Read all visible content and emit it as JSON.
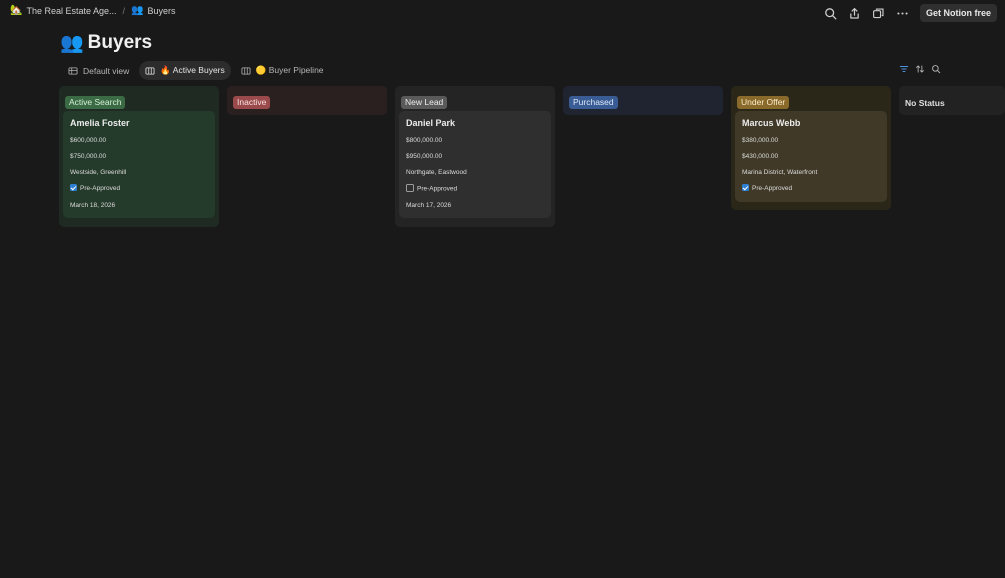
{
  "breadcrumb": {
    "workspace": "The Real Estate Age...",
    "workspace_icon": "🏡",
    "separator": "/",
    "page": "Buyers",
    "page_icon": "👥"
  },
  "top_actions": {
    "icons": [
      "search-icon",
      "share-icon",
      "duplicate-icon",
      "more-icon"
    ],
    "cta_label": "Get Notion free"
  },
  "page": {
    "icon": "👥",
    "title": "Buyers"
  },
  "views": [
    {
      "label": "Default view",
      "icon": "table-icon",
      "active": false
    },
    {
      "label": "🔥 Active Buyers",
      "icon": "board-icon",
      "active": true
    },
    {
      "label": "🟡 Buyer Pipeline",
      "icon": "board-icon",
      "active": false
    }
  ],
  "view_tools": [
    "filter-icon",
    "sort-icon",
    "search-icon"
  ],
  "columns": [
    {
      "status": "Active Search",
      "color": "#3b6b44",
      "text_color": "#d7f0d9",
      "bg": "#1f2a22",
      "cards": [
        {
          "name": "Amelia Foster",
          "budget_min": "$600,000.00",
          "budget_max": "$750,000.00",
          "areas": "Westside, Greenhill",
          "pre_approved_label": "Pre-Approved",
          "pre_approved": true,
          "date": "March 18, 2026"
        }
      ]
    },
    {
      "status": "Inactive",
      "color": "#9a4a4a",
      "text_color": "#fbe2e2",
      "bg": "#2b2020",
      "cards": []
    },
    {
      "status": "New Lead",
      "color": "#5a5a5a",
      "text_color": "#ededed",
      "bg": "#242424",
      "cards": [
        {
          "name": "Daniel Park",
          "budget_min": "$800,000.00",
          "budget_max": "$950,000.00",
          "areas": "Northgate, Eastwood",
          "pre_approved_label": "Pre-Approved",
          "pre_approved": false,
          "date": "March 17, 2026"
        }
      ]
    },
    {
      "status": "Purchased",
      "color": "#3a5c94",
      "text_color": "#dce8fa",
      "bg": "#1f2430",
      "cards": []
    },
    {
      "status": "Under Offer",
      "color": "#8a6a2a",
      "text_color": "#fbecc9",
      "bg": "#2a2618",
      "cards": [
        {
          "name": "Marcus Webb",
          "budget_min": "$380,000.00",
          "budget_max": "$430,000.00",
          "areas": "Marina District, Waterfront",
          "pre_approved_label": "Pre-Approved",
          "pre_approved": true,
          "date": ""
        }
      ]
    },
    {
      "status": "No Status",
      "color": "",
      "text_color": "#e0e0e0",
      "bg": "#222222",
      "cards": []
    }
  ]
}
